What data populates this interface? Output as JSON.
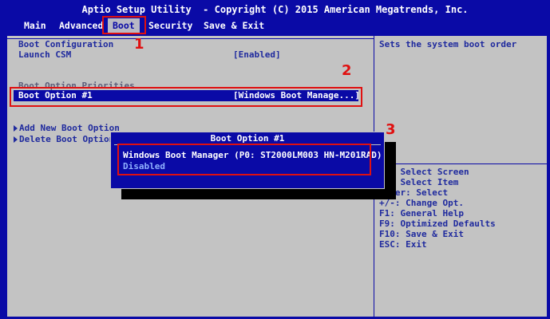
{
  "title": "Aptio Setup Utility  - Copyright (C) 2015 American Megatrends, Inc.",
  "tabs": [
    {
      "label": "Main"
    },
    {
      "label": "Advanced"
    },
    {
      "label": "Boot"
    },
    {
      "label": "Security"
    },
    {
      "label": "Save & Exit"
    }
  ],
  "main": {
    "section_boot_config": "Boot Configuration",
    "launch_csm_label": "Launch CSM",
    "launch_csm_value": "[Enabled]",
    "section_priorities": "Boot Option Priorities",
    "boot_option1_label": "Boot Option #1",
    "boot_option1_value": "[Windows Boot Manage...]",
    "add_boot_option": "Add New Boot Option",
    "delete_boot_option": "Delete Boot Option"
  },
  "help": {
    "description": "Sets the system boot order",
    "keys": [
      "><: Select Screen",
      "^v: Select Item",
      "Enter: Select",
      "+/-: Change Opt.",
      "F1: General Help",
      "F9: Optimized Defaults",
      "F10: Save & Exit",
      "ESC: Exit"
    ]
  },
  "popup": {
    "title": "Boot Option #1",
    "options": [
      "Windows Boot Manager (P0: ST2000LM003 HN-M201RAD)",
      "Disabled"
    ]
  },
  "annotations": [
    "1",
    "2",
    "3"
  ],
  "colors": {
    "background": "#0a0aa6",
    "panel": "#c3c3c3",
    "highlight": "#e01010"
  }
}
